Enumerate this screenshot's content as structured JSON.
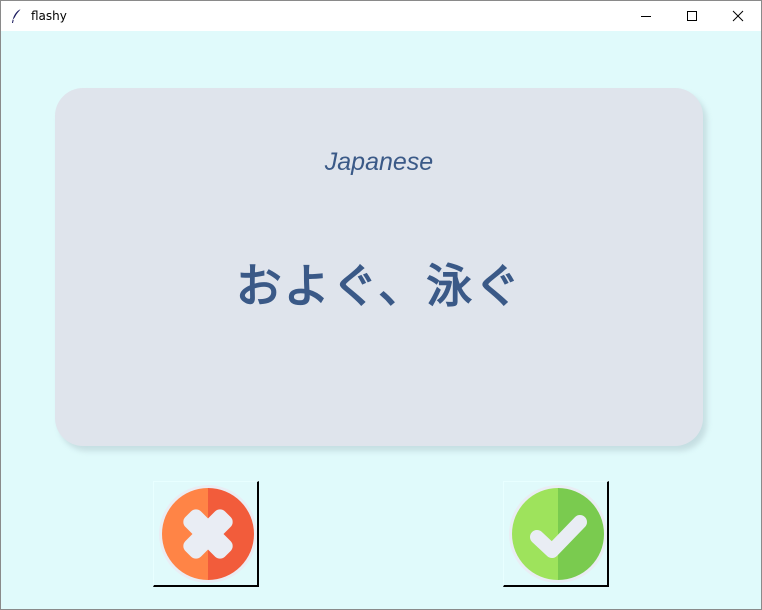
{
  "window": {
    "title": "flashy",
    "icon": "feather-icon",
    "controls": [
      "minimize-icon",
      "maximize-icon",
      "close-icon"
    ]
  },
  "card": {
    "language": "Japanese",
    "word": "およぐ、泳ぐ",
    "background_color": "#dfe4ec",
    "text_color": "#3a5987"
  },
  "buttons": {
    "wrong": {
      "icon": "cross-icon",
      "color": "#f25c3b"
    },
    "right": {
      "icon": "checkmark-icon",
      "color": "#7acb4f"
    }
  },
  "theme": {
    "background": "#e0fafb"
  }
}
